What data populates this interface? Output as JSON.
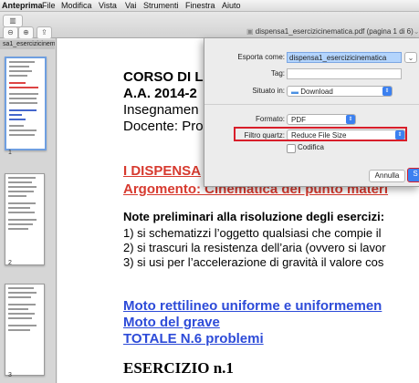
{
  "menubar": {
    "app_name": "Anteprima",
    "items": [
      "File",
      "Modifica",
      "Vista",
      "Vai",
      "Strumenti",
      "Finestra",
      "Aiuto"
    ]
  },
  "window": {
    "title": "dispensa1_esercizicinematica.pdf (pagina 1 di 6)",
    "title_caret": "⌄"
  },
  "sidebar": {
    "tab_label": "sa1_esercizicinema",
    "page_numbers": [
      "1",
      "2",
      "3"
    ]
  },
  "document": {
    "line1": "CORSO DI L",
    "line2": "A.A. 2014-2",
    "line3": "Insegnamen",
    "line4": "Docente: Pro",
    "heading1": "I DISPENSA",
    "heading2": "Argomento: Cinematica del punto materi",
    "notes_title": "Note preliminari alla risoluzione degli esercizi:",
    "note1": "1) si schematizzi l’oggetto qualsiasi che compie il",
    "note2": "2) si trascuri la resistenza dell’aria (ovvero si lavor",
    "note3": "3) si usi per l’accelerazione di gravità il valore cos",
    "link1": "Moto rettilineo uniforme e uniformemen",
    "link2": "Moto del grave",
    "link3": "TOTALE N.6 problemi",
    "exercise": "ESERCIZIO n.1"
  },
  "dialog": {
    "export_as_label": "Esporta come:",
    "export_as_value": "dispensa1_esercizicinematica",
    "tags_label": "Tag:",
    "location_label": "Situato in:",
    "location_value": "Download",
    "format_label": "Formato:",
    "format_value": "PDF",
    "quartz_label": "Filtro quartz:",
    "quartz_value": "Reduce File Size",
    "encrypt_label": "Codifica",
    "cancel_label": "Annulla",
    "save_label": "S",
    "expand_icon": "⌄",
    "stepper_icon": "⇕",
    "accent_color": "#3b80f0",
    "highlight_color": "#d81e2a"
  }
}
